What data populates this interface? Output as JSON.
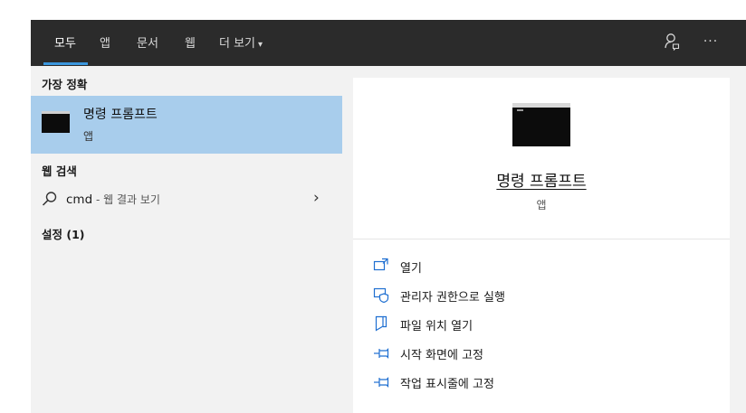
{
  "header": {
    "tabs": [
      {
        "label": "모두",
        "active": true
      },
      {
        "label": "앱"
      },
      {
        "label": "문서"
      },
      {
        "label": "웹"
      },
      {
        "label": "더 보기"
      }
    ],
    "more_caret": "▾",
    "more_options": "···"
  },
  "best_match": {
    "heading": "가장 정확",
    "title": "명령 프롬프트",
    "subtitle": "앱"
  },
  "web_search": {
    "heading": "웹 검색",
    "query": "cmd",
    "suffix": " - 웹 결과 보기",
    "arrow": "›"
  },
  "settings": {
    "heading": "설정 (1)"
  },
  "preview": {
    "title": "명령 프롬프트",
    "subtitle": "앱",
    "actions": [
      {
        "label": "열기",
        "icon": "open-icon"
      },
      {
        "label": "관리자 권한으로 실행",
        "icon": "shield-icon"
      },
      {
        "label": "파일 위치 열기",
        "icon": "file-icon"
      },
      {
        "label": "시작 화면에 고정",
        "icon": "pin-icon"
      },
      {
        "label": "작업 표시줄에 고정",
        "icon": "pin-icon"
      }
    ]
  },
  "colors": {
    "accent": "#3a96dd",
    "selection": "#a8cdec",
    "topbar": "#2b2b2b",
    "icon_blue": "#1f6fd1"
  }
}
